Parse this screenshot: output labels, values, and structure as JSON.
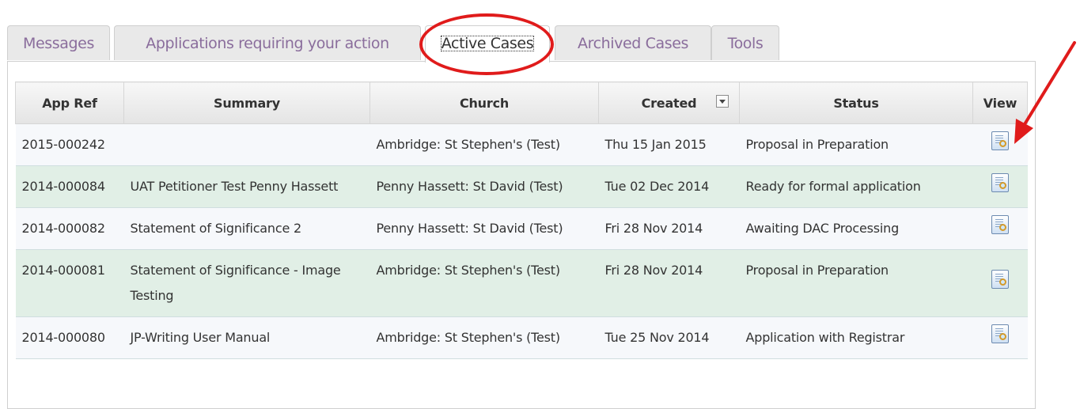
{
  "tabs": [
    {
      "label": "Messages",
      "active": false
    },
    {
      "label": "Applications requiring your action",
      "active": false
    },
    {
      "label": "Active Cases",
      "active": true
    },
    {
      "label": "Archived Cases",
      "active": false
    },
    {
      "label": "Tools",
      "active": false
    }
  ],
  "table": {
    "headers": {
      "app_ref": "App Ref",
      "summary": "Summary",
      "church": "Church",
      "created": "Created",
      "status": "Status",
      "view": "View"
    },
    "rows": [
      {
        "app_ref": "2015-000242",
        "summary": "",
        "church": "Ambridge: St Stephen's (Test)",
        "created": "Thu 15 Jan 2015",
        "status": "Proposal in Preparation"
      },
      {
        "app_ref": "2014-000084",
        "summary": "UAT Petitioner Test Penny Hassett",
        "church": "Penny Hassett: St David (Test)",
        "created": "Tue 02 Dec 2014",
        "status": "Ready for formal application"
      },
      {
        "app_ref": "2014-000082",
        "summary": "Statement of Significance 2",
        "church": "Penny Hassett: St David (Test)",
        "created": "Fri 28 Nov 2014",
        "status": "Awaiting DAC Processing"
      },
      {
        "app_ref": "2014-000081",
        "summary": "Statement of Significance - Image Testing",
        "church": "Ambridge: St Stephen's (Test)",
        "created": "Fri 28 Nov 2014",
        "status": "Proposal in Preparation"
      },
      {
        "app_ref": "2014-000080",
        "summary": "JP-Writing User Manual",
        "church": "Ambridge: St Stephen's (Test)",
        "created": "Tue 25 Nov 2014",
        "status": "Application with Registrar"
      }
    ]
  },
  "icons": {
    "view": "view-document-icon",
    "sort": "sort-dropdown-icon"
  },
  "colors": {
    "tab_text": "#8a6d9c",
    "row_odd": "#f6f8fb",
    "row_even": "#e1efe6",
    "annotation": "#e01b1b"
  }
}
